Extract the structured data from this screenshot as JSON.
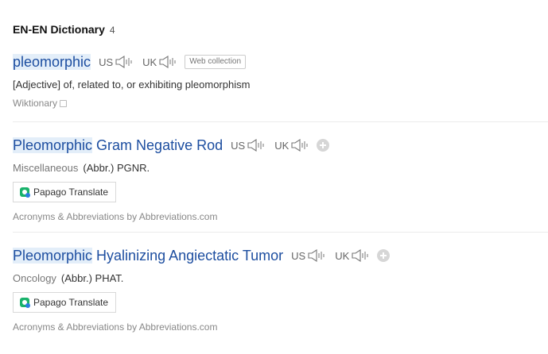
{
  "section": {
    "title": "EN-EN Dictionary",
    "count": "4"
  },
  "pron_labels": {
    "us": "US",
    "uk": "UK"
  },
  "entries": [
    {
      "highlight": "pleomorphic",
      "rest": "",
      "tag": "Web collection",
      "category": "",
      "definition": "[Adjective] of, related to, or exhibiting pleomorphism",
      "source": "Wiktionary"
    },
    {
      "highlight": "Pleomorphic",
      "rest": "Gram Negative Rod",
      "category": "Miscellaneous",
      "definition": "(Abbr.) PGNR.",
      "button": "Papago Translate",
      "source": "Acronyms & Abbreviations by Abbreviations.com"
    },
    {
      "highlight": "Pleomorphic",
      "rest": "Hyalinizing Angiectatic Tumor",
      "category": "Oncology",
      "definition": "(Abbr.) PHAT.",
      "button": "Papago Translate",
      "source": "Acronyms & Abbreviations by Abbreviations.com"
    }
  ],
  "colors": {
    "link": "#1d4ea0",
    "highlight": "#e3eef9",
    "papago_green": "#19b26b"
  },
  "icons": [
    "speaker-icon",
    "add-icon",
    "square-icon",
    "papago-icon"
  ]
}
